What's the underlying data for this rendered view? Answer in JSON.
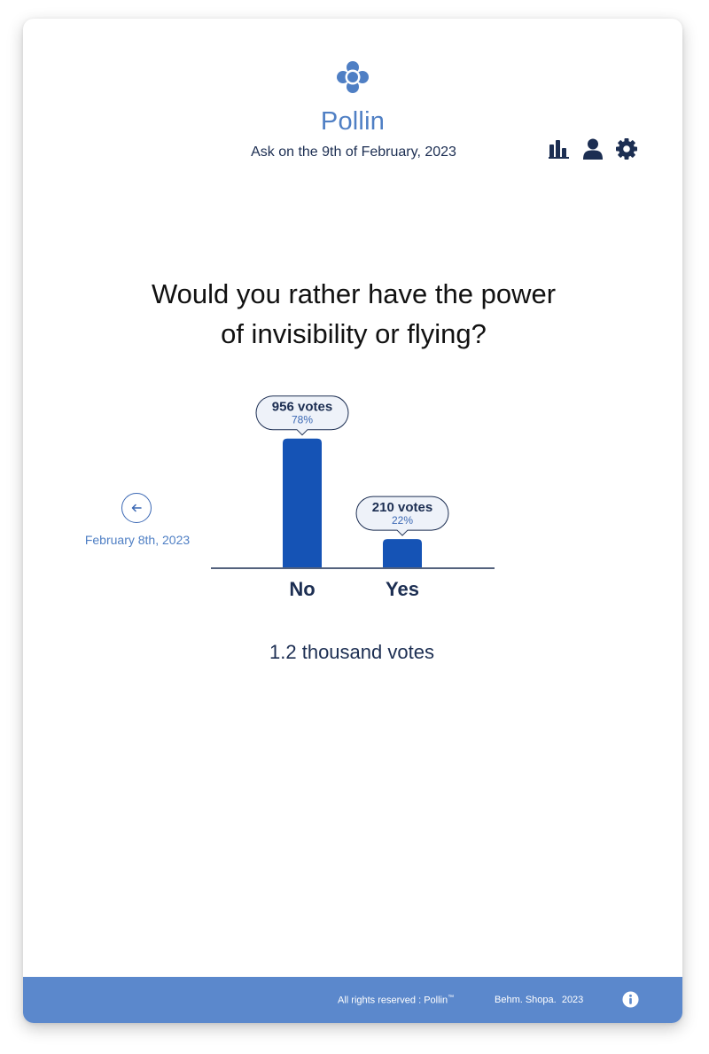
{
  "app": {
    "name": "Pollin",
    "subtitle": "Ask on the 9th of February, 2023",
    "logo_icon": "flower-logo-icon"
  },
  "toolbar": {
    "items": [
      {
        "icon": "bar-chart-icon"
      },
      {
        "icon": "user-icon"
      },
      {
        "icon": "gear-icon"
      }
    ]
  },
  "poll": {
    "question_line1": "Would you rather have the power",
    "question_line2": "of invisibility or flying?",
    "total_votes": "1.2 thousand votes",
    "previous": {
      "icon": "arrow-left-icon",
      "label": "February 8th, 2023"
    }
  },
  "chart_data": {
    "type": "bar",
    "categories": [
      "No",
      "Yes"
    ],
    "values": [
      956,
      210
    ],
    "percent_labels": [
      "78%",
      "22%"
    ],
    "vote_labels": [
      "956 votes",
      "210 votes"
    ],
    "ylim": [
      0,
      1000
    ],
    "grid": false,
    "bar_color": "#1553b5"
  },
  "footer": {
    "rights": "All rights reserved : Pollin",
    "trademark": "™",
    "credit": "Behm. Shopa.  2023",
    "info_icon": "info-icon"
  },
  "colors": {
    "accent": "#4f7fc4",
    "bar": "#1553b5",
    "dark_text": "#1c2e52",
    "footer": "#5b88cc",
    "bubble": "#eef2f9"
  }
}
